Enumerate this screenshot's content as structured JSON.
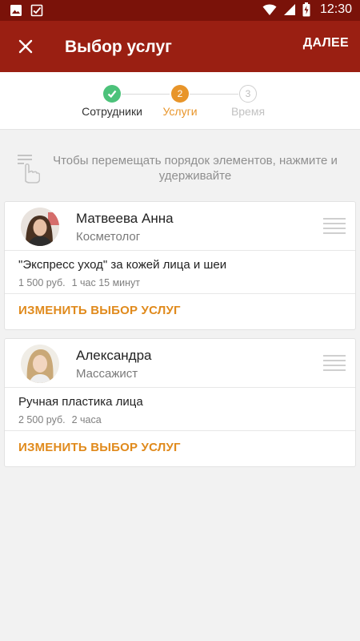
{
  "status_bar": {
    "time": "12:30",
    "icons": [
      "image-icon",
      "checkbox-icon",
      "wifi-icon",
      "signal-icon",
      "battery-charging-icon"
    ]
  },
  "app_bar": {
    "title": "Выбор услуг",
    "next_label": "ДАЛЕЕ",
    "close_icon": "close-icon",
    "color": "#9a1f12"
  },
  "stepper": {
    "steps": [
      {
        "label": "Сотрудники",
        "number": "1",
        "state": "done",
        "color": "#4cc27a"
      },
      {
        "label": "Услуги",
        "number": "2",
        "state": "active",
        "color": "#e8952a"
      },
      {
        "label": "Время",
        "number": "3",
        "state": "pending",
        "color": "#cccccc"
      }
    ]
  },
  "hint": {
    "text": "Чтобы перемещать порядок элементов, нажмите и удерживайте",
    "icon": "touch-hold-icon"
  },
  "cards": [
    {
      "employee": {
        "name": "Матвеева Анна",
        "role": "Косметолог"
      },
      "service": {
        "name": "\"Экспресс уход\" за кожей лица и шеи",
        "price": "1 500 руб.",
        "duration": "1 час 15 минут"
      },
      "change_label": "ИЗМЕНИТЬ ВЫБОР УСЛУГ"
    },
    {
      "employee": {
        "name": "Александра",
        "role": "Массажист"
      },
      "service": {
        "name": "Ручная пластика лица",
        "price": "2 500 руб.",
        "duration": "2 часа"
      },
      "change_label": "ИЗМЕНИТЬ ВЫБОР УСЛУГ"
    }
  ],
  "colors": {
    "accent": "#e08a1c",
    "status_bar": "#7a1209",
    "background": "#f2f2f2"
  }
}
